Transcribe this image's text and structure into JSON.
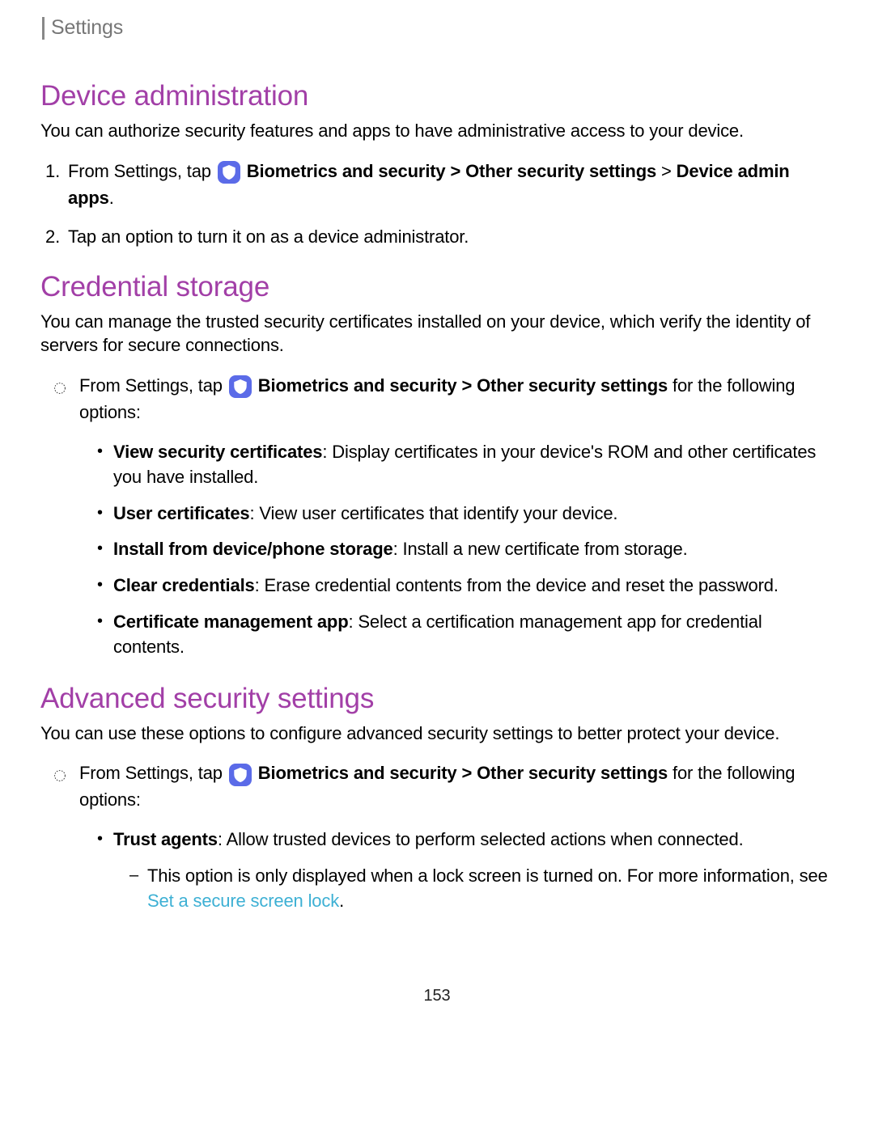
{
  "header": "Settings",
  "sections": [
    {
      "title": "Device administration",
      "desc": "You can authorize security features and apps to have administrative access to your device.",
      "steps": [
        {
          "type": "numbered",
          "num": "1.",
          "prefix": "From Settings, tap ",
          "bold1": "Biometrics and security",
          "sep1": " > ",
          "bold2": "Other security settings",
          "sep2": " > ",
          "bold3": "Device admin apps",
          "suffix": "."
        },
        {
          "type": "numbered",
          "num": "2.",
          "text": "Tap an option to turn it on as a device administrator."
        }
      ]
    },
    {
      "title": "Credential storage",
      "desc": "You can manage the trusted security certificates installed on your device, which verify the identity of servers for secure connections.",
      "circleItem": {
        "prefix": "From Settings, tap ",
        "bold1": "Biometrics and security",
        "sep1": " > ",
        "bold2": "Other security settings",
        "suffix": " for the following options:"
      },
      "bullets": [
        {
          "bold": "View security certificates",
          "text": ": Display certificates in your device's ROM and other certificates you have installed."
        },
        {
          "bold": "User certificates",
          "text": ": View user certificates that identify your device."
        },
        {
          "bold": "Install from device/phone storage",
          "text": ": Install a new certificate from storage."
        },
        {
          "bold": "Clear credentials",
          "text": ": Erase credential contents from the device and reset the password."
        },
        {
          "bold": "Certificate management app",
          "text": ": Select a certification management app for credential contents."
        }
      ]
    },
    {
      "title": "Advanced security settings",
      "desc": "You can use these options to configure advanced security settings to better protect your device.",
      "circleItem": {
        "prefix": "From Settings, tap ",
        "bold1": "Biometrics and security",
        "sep1": " > ",
        "bold2": "Other security settings",
        "suffix": " for the following options:"
      },
      "bullets2": [
        {
          "bold": "Trust agents",
          "text": ": Allow trusted devices to perform selected actions when connected.",
          "sub": {
            "text": "This option is only displayed when a lock screen is turned on. For more information, see ",
            "link": "Set a secure screen lock",
            "after": "."
          }
        }
      ]
    }
  ],
  "pageNumber": "153"
}
